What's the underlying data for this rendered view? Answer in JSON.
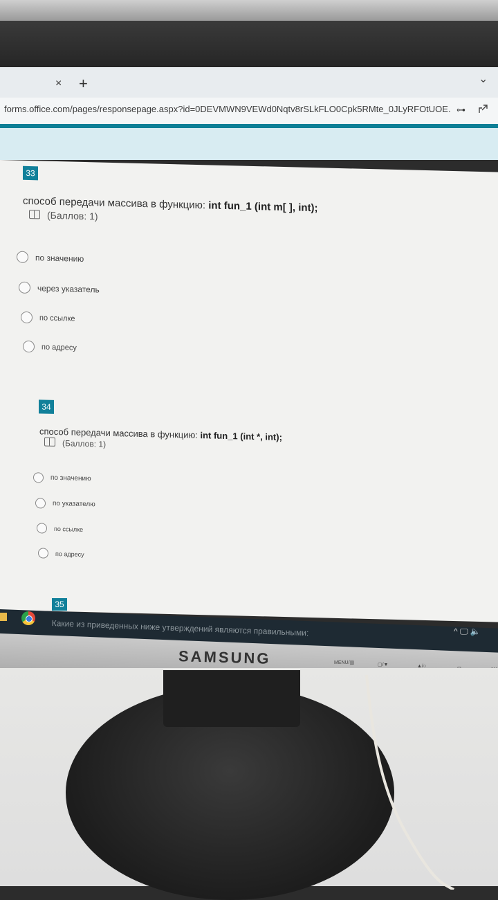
{
  "browser": {
    "tab_close": "×",
    "tab_new": "+",
    "tab_menu": "⌄",
    "url": "forms.office.com/pages/responsepage.aspx?id=0DEVMWN9VEWd0Nqtv8rSLkFLO0Cpk5RMte_0JLyRFOtUOE...",
    "key_glyph": "⊶"
  },
  "questions": [
    {
      "number": "33",
      "text_prefix": "способ передачи массива в функцию: ",
      "code": "int  fun_1 (int m[ ], int);",
      "points": "(Баллов: 1)",
      "options": [
        "по значению",
        "через указатель",
        "по ссылке",
        "по адресу"
      ]
    },
    {
      "number": "34",
      "text_prefix": "способ передачи массива в функцию: ",
      "code": "int  fun_1 (int *, int);",
      "points": "(Баллов: 1)",
      "options": [
        "по значению",
        "по указателю",
        "по ссылке",
        "по адресу"
      ]
    },
    {
      "number": "35",
      "text": "Какие из приведенных ниже утверждений являются правильными:"
    }
  ],
  "taskbar": {
    "tray": "^ 🖵 🔈"
  },
  "monitor": {
    "brand": "SAMSUNG",
    "buttons": [
      "MENU/▥",
      "▢/▼",
      "▲/○",
      "⊟",
      "AU"
    ]
  },
  "colors": {
    "accent": "#11809a",
    "page": "#f2f2f0"
  }
}
